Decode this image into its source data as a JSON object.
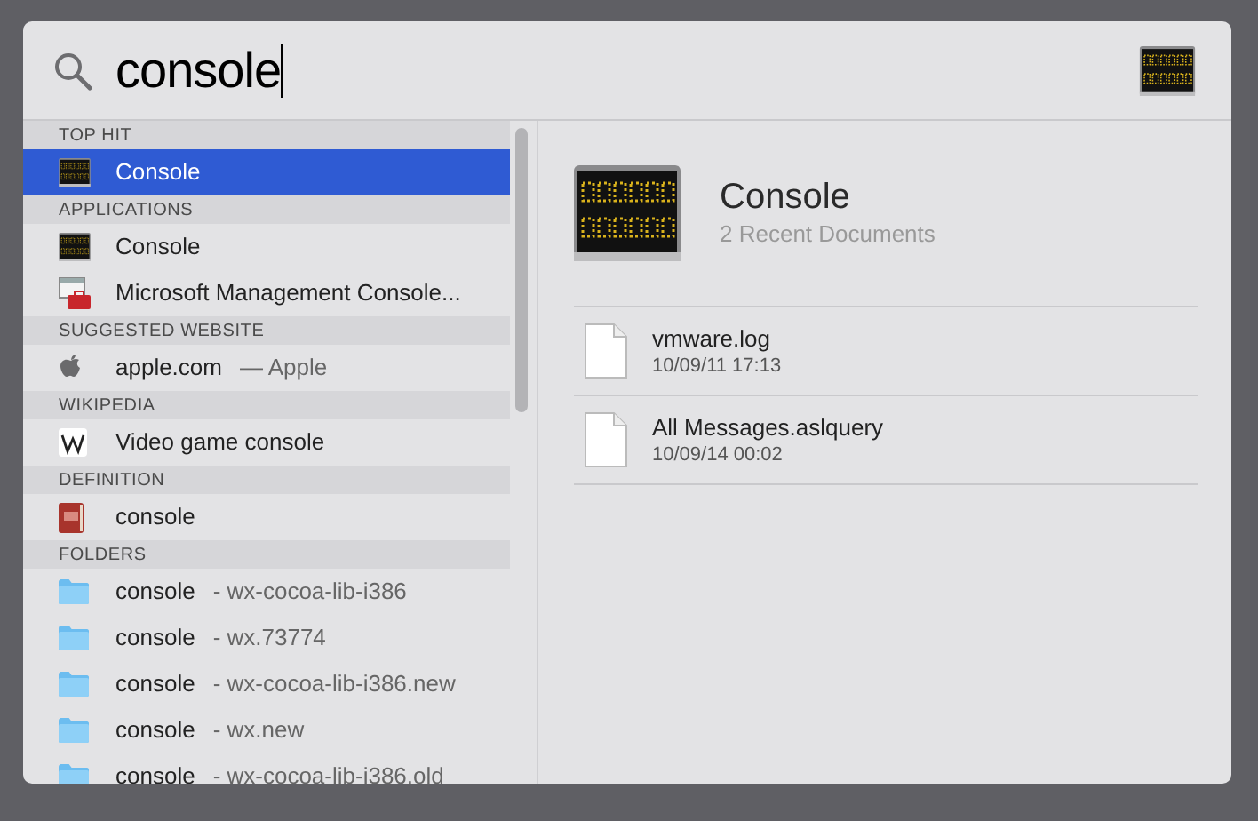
{
  "search": {
    "value": "console"
  },
  "results": [
    {
      "kind": "header",
      "label": "TOP HIT"
    },
    {
      "kind": "app",
      "label": "Console",
      "selected": true
    },
    {
      "kind": "header",
      "label": "APPLICATIONS"
    },
    {
      "kind": "app",
      "label": "Console",
      "selected": false
    },
    {
      "kind": "tool",
      "label": "Microsoft Management Console...",
      "selected": false
    },
    {
      "kind": "header",
      "label": "SUGGESTED WEBSITE"
    },
    {
      "kind": "website",
      "label": "apple.com",
      "detail": "— Apple",
      "selected": false
    },
    {
      "kind": "header",
      "label": "WIKIPEDIA"
    },
    {
      "kind": "article",
      "label": "Video game console",
      "selected": false
    },
    {
      "kind": "header",
      "label": "DEFINITION"
    },
    {
      "kind": "definition",
      "label": "console",
      "selected": false
    },
    {
      "kind": "header",
      "label": "FOLDERS"
    },
    {
      "kind": "folder",
      "label": "console",
      "detail": "- wx-cocoa-lib-i386",
      "selected": false
    },
    {
      "kind": "folder",
      "label": "console",
      "detail": "- wx.73774",
      "selected": false
    },
    {
      "kind": "folder",
      "label": "console",
      "detail": "- wx-cocoa-lib-i386.new",
      "selected": false
    },
    {
      "kind": "folder",
      "label": "console",
      "detail": "- wx.new",
      "selected": false
    },
    {
      "kind": "folder",
      "label": "console",
      "detail": "- wx-cocoa-lib-i386.old",
      "selected": false
    }
  ],
  "preview": {
    "title": "Console",
    "subtitle": "2 Recent Documents",
    "documents": [
      {
        "name": "vmware.log",
        "date": "10/09/11 17:13"
      },
      {
        "name": "All Messages.aslquery",
        "date": "10/09/14 00:02"
      }
    ]
  }
}
